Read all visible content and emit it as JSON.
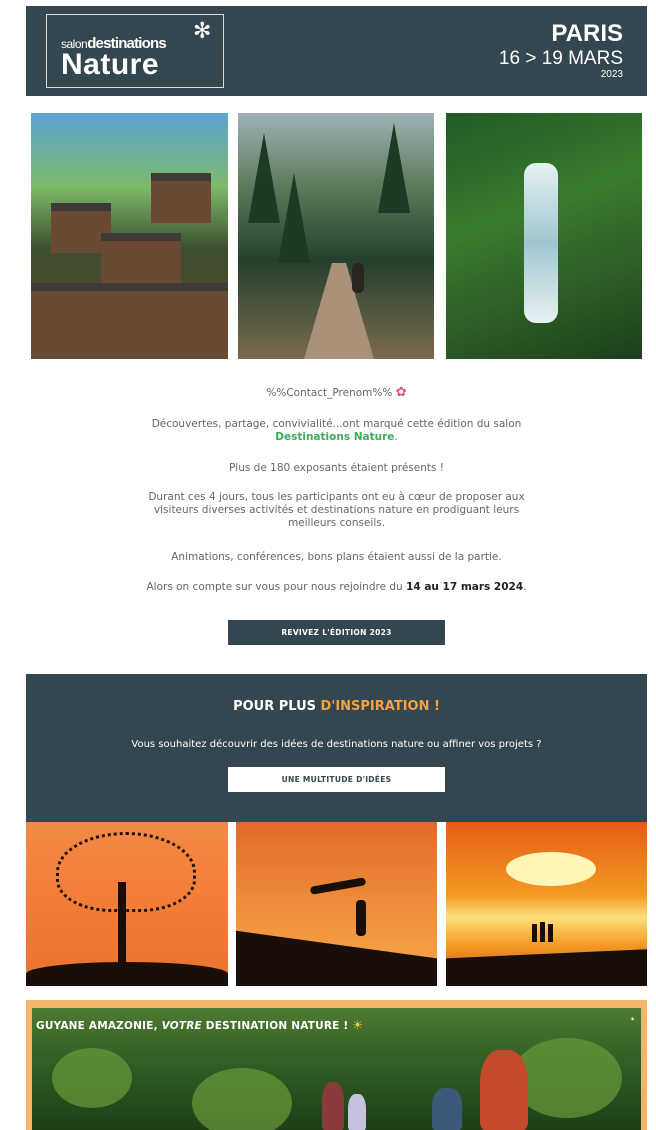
{
  "header": {
    "logo_small_prefix": "salon",
    "logo_small_main": "destinations",
    "logo_big": "Nature",
    "city": "PARIS",
    "dates": "16 > 19 MARS",
    "year": "2023",
    "bg_color": "#34464f"
  },
  "body": {
    "greeting": "%%Contact_Prenom%%",
    "p1_text": "Découvertes, partage, convivialité...ont marqué cette édition du salon",
    "p1_link": "Destinations Nature",
    "p1_end": ".",
    "p2": "Plus de 180 exposants étaient présents !",
    "p3_line1": "Durant ces 4 jours, tous les participants ont eu à cœur de proposer aux",
    "p3_line2": "visiteurs diverses activités et destinations nature en prodiguant leurs",
    "p3_line3": "meilleurs conseils.",
    "p4": "Animations, conférences, bons plans étaient aussi de la partie.",
    "p5_text": "Alors on compte sur vous pour nous rejoindre du",
    "p5_bold": "14 au 17 mars 2024",
    "p5_end": ".",
    "cta_label": "REVIVEZ L'ÉDITION 2023",
    "accent_green": "#3dab5b"
  },
  "inspiration": {
    "title_white": "POUR PLUS",
    "title_orange": "D'INSPIRATION !",
    "text": "Vous souhaitez découvrir des idées de destinations nature ou affiner vos projets ?",
    "cta_label": "UNE MULTITUDE D'IDÉES",
    "accent_orange": "#f1a243"
  },
  "banner": {
    "title_part1": "GUYANE AMAZONIE,",
    "title_em": "VOTRE",
    "title_part2": "DESTINATION NATURE !",
    "frame_color": "#f6b36a"
  }
}
